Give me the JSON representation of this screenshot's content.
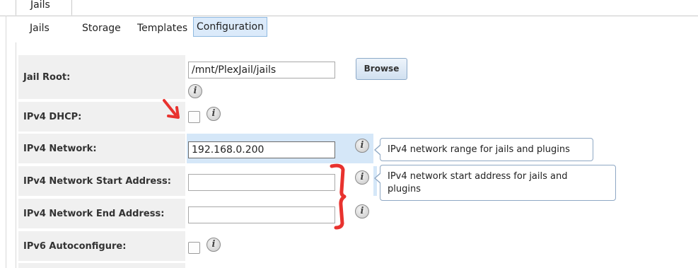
{
  "top_tab": {
    "label": "Jails"
  },
  "subtabs": [
    {
      "label": "Jails"
    },
    {
      "label": "Storage"
    },
    {
      "label": "Templates"
    },
    {
      "label": "Configuration"
    }
  ],
  "form": {
    "jail_root": {
      "label": "Jail Root:",
      "value": "/mnt/PlexJail/jails",
      "browse_label": "Browse"
    },
    "ipv4_dhcp": {
      "label": "IPv4 DHCP:",
      "checked": false
    },
    "ipv4_network": {
      "label": "IPv4 Network:",
      "value": "192.168.0.200",
      "tooltip": "IPv4 network range for jails and plugins"
    },
    "ipv4_start": {
      "label": "IPv4 Network Start Address:",
      "value": "",
      "tooltip_line1": "IPv4 network start address for jails and",
      "tooltip_line2": "plugins"
    },
    "ipv4_end": {
      "label": "IPv4 Network End Address:",
      "value": ""
    },
    "ipv6_auto": {
      "label": "IPv6 Autoconfigure:",
      "checked": false
    }
  },
  "icons": {
    "info": "info-icon",
    "annotation_arrow": "red-arrow",
    "annotation_bracket": "red-bracket"
  },
  "colors": {
    "accent": "#d5e7f8",
    "annotation": "#e8322e"
  }
}
